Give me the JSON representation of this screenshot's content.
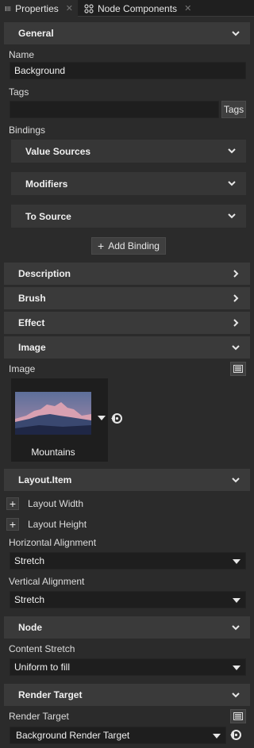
{
  "tabs": [
    {
      "label": "Properties",
      "icon": "properties-icon",
      "close": "✕"
    },
    {
      "label": "Node Components",
      "icon": "node-components-icon",
      "close": "✕"
    }
  ],
  "general": {
    "title": "General",
    "name_label": "Name",
    "name_value": "Background",
    "tags_label": "Tags",
    "tags_value": "",
    "tags_button": "Tags",
    "bindings_label": "Bindings",
    "value_sources": "Value Sources",
    "modifiers": "Modifiers",
    "to_source": "To Source",
    "add_binding": "Add Binding"
  },
  "sections": {
    "description": "Description",
    "brush": "Brush",
    "effect": "Effect",
    "image": "Image",
    "layout_item": "Layout.Item",
    "node": "Node",
    "render_target": "Render Target"
  },
  "image": {
    "image_label": "Image",
    "thumbnail_caption": "Mountains"
  },
  "layout": {
    "layout_width": "Layout Width",
    "layout_height": "Layout Height",
    "h_align_label": "Horizontal Alignment",
    "h_align_value": "Stretch",
    "v_align_label": "Vertical Alignment",
    "v_align_value": "Stretch"
  },
  "node": {
    "content_stretch_label": "Content Stretch",
    "content_stretch_value": "Uniform to fill"
  },
  "render_target": {
    "label": "Render Target",
    "value": "Background Render Target"
  }
}
